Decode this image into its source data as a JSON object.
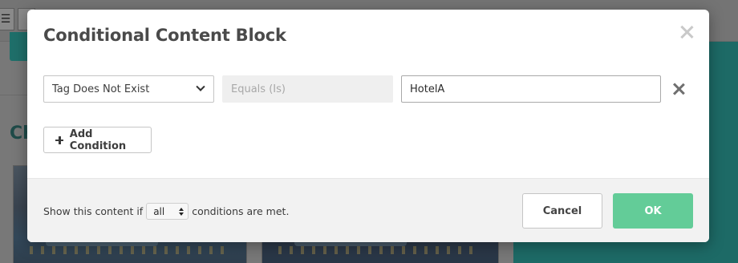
{
  "background": {
    "toolbar_icon": "list-icon",
    "heading_fragment": "Ch"
  },
  "modal": {
    "title": "Conditional Content Block",
    "condition": {
      "type_selected": "Tag Does Not Exist",
      "operator_placeholder": "Equals (Is)",
      "value": "HotelA"
    },
    "add_condition_label": "Add Condition",
    "footer": {
      "prefix": "Show this content if",
      "match_selected": "all",
      "suffix": "conditions are met."
    },
    "cancel_label": "Cancel",
    "ok_label": "OK"
  },
  "colors": {
    "ok_button": "#63cc98",
    "background_teal": "#1d6a66",
    "operator_field_bg": "#efefef",
    "footer_bg": "#f2f2f2"
  }
}
